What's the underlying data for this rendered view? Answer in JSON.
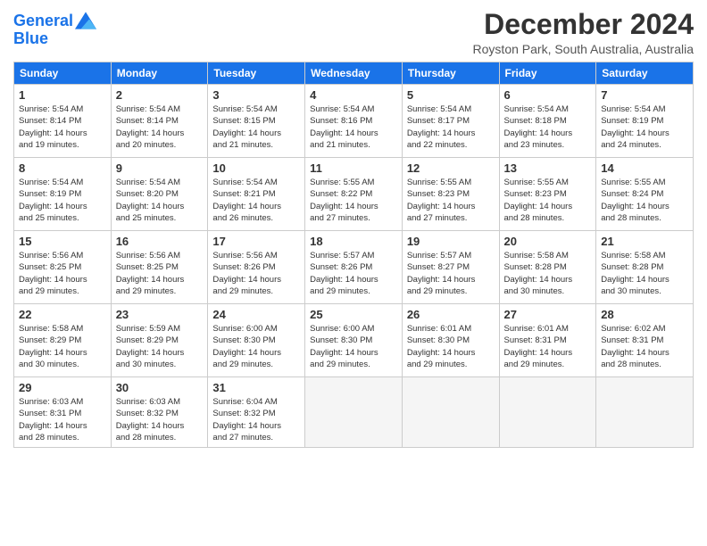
{
  "logo": {
    "line1": "General",
    "line2": "Blue"
  },
  "title": "December 2024",
  "subtitle": "Royston Park, South Australia, Australia",
  "days_header": [
    "Sunday",
    "Monday",
    "Tuesday",
    "Wednesday",
    "Thursday",
    "Friday",
    "Saturday"
  ],
  "weeks": [
    [
      {
        "day": "1",
        "info": "Sunrise: 5:54 AM\nSunset: 8:14 PM\nDaylight: 14 hours\nand 19 minutes."
      },
      {
        "day": "2",
        "info": "Sunrise: 5:54 AM\nSunset: 8:14 PM\nDaylight: 14 hours\nand 20 minutes."
      },
      {
        "day": "3",
        "info": "Sunrise: 5:54 AM\nSunset: 8:15 PM\nDaylight: 14 hours\nand 21 minutes."
      },
      {
        "day": "4",
        "info": "Sunrise: 5:54 AM\nSunset: 8:16 PM\nDaylight: 14 hours\nand 21 minutes."
      },
      {
        "day": "5",
        "info": "Sunrise: 5:54 AM\nSunset: 8:17 PM\nDaylight: 14 hours\nand 22 minutes."
      },
      {
        "day": "6",
        "info": "Sunrise: 5:54 AM\nSunset: 8:18 PM\nDaylight: 14 hours\nand 23 minutes."
      },
      {
        "day": "7",
        "info": "Sunrise: 5:54 AM\nSunset: 8:19 PM\nDaylight: 14 hours\nand 24 minutes."
      }
    ],
    [
      {
        "day": "8",
        "info": "Sunrise: 5:54 AM\nSunset: 8:19 PM\nDaylight: 14 hours\nand 25 minutes."
      },
      {
        "day": "9",
        "info": "Sunrise: 5:54 AM\nSunset: 8:20 PM\nDaylight: 14 hours\nand 25 minutes."
      },
      {
        "day": "10",
        "info": "Sunrise: 5:54 AM\nSunset: 8:21 PM\nDaylight: 14 hours\nand 26 minutes."
      },
      {
        "day": "11",
        "info": "Sunrise: 5:55 AM\nSunset: 8:22 PM\nDaylight: 14 hours\nand 27 minutes."
      },
      {
        "day": "12",
        "info": "Sunrise: 5:55 AM\nSunset: 8:23 PM\nDaylight: 14 hours\nand 27 minutes."
      },
      {
        "day": "13",
        "info": "Sunrise: 5:55 AM\nSunset: 8:23 PM\nDaylight: 14 hours\nand 28 minutes."
      },
      {
        "day": "14",
        "info": "Sunrise: 5:55 AM\nSunset: 8:24 PM\nDaylight: 14 hours\nand 28 minutes."
      }
    ],
    [
      {
        "day": "15",
        "info": "Sunrise: 5:56 AM\nSunset: 8:25 PM\nDaylight: 14 hours\nand 29 minutes."
      },
      {
        "day": "16",
        "info": "Sunrise: 5:56 AM\nSunset: 8:25 PM\nDaylight: 14 hours\nand 29 minutes."
      },
      {
        "day": "17",
        "info": "Sunrise: 5:56 AM\nSunset: 8:26 PM\nDaylight: 14 hours\nand 29 minutes."
      },
      {
        "day": "18",
        "info": "Sunrise: 5:57 AM\nSunset: 8:26 PM\nDaylight: 14 hours\nand 29 minutes."
      },
      {
        "day": "19",
        "info": "Sunrise: 5:57 AM\nSunset: 8:27 PM\nDaylight: 14 hours\nand 29 minutes."
      },
      {
        "day": "20",
        "info": "Sunrise: 5:58 AM\nSunset: 8:28 PM\nDaylight: 14 hours\nand 30 minutes."
      },
      {
        "day": "21",
        "info": "Sunrise: 5:58 AM\nSunset: 8:28 PM\nDaylight: 14 hours\nand 30 minutes."
      }
    ],
    [
      {
        "day": "22",
        "info": "Sunrise: 5:58 AM\nSunset: 8:29 PM\nDaylight: 14 hours\nand 30 minutes."
      },
      {
        "day": "23",
        "info": "Sunrise: 5:59 AM\nSunset: 8:29 PM\nDaylight: 14 hours\nand 30 minutes."
      },
      {
        "day": "24",
        "info": "Sunrise: 6:00 AM\nSunset: 8:30 PM\nDaylight: 14 hours\nand 29 minutes."
      },
      {
        "day": "25",
        "info": "Sunrise: 6:00 AM\nSunset: 8:30 PM\nDaylight: 14 hours\nand 29 minutes."
      },
      {
        "day": "26",
        "info": "Sunrise: 6:01 AM\nSunset: 8:30 PM\nDaylight: 14 hours\nand 29 minutes."
      },
      {
        "day": "27",
        "info": "Sunrise: 6:01 AM\nSunset: 8:31 PM\nDaylight: 14 hours\nand 29 minutes."
      },
      {
        "day": "28",
        "info": "Sunrise: 6:02 AM\nSunset: 8:31 PM\nDaylight: 14 hours\nand 28 minutes."
      }
    ],
    [
      {
        "day": "29",
        "info": "Sunrise: 6:03 AM\nSunset: 8:31 PM\nDaylight: 14 hours\nand 28 minutes."
      },
      {
        "day": "30",
        "info": "Sunrise: 6:03 AM\nSunset: 8:32 PM\nDaylight: 14 hours\nand 28 minutes."
      },
      {
        "day": "31",
        "info": "Sunrise: 6:04 AM\nSunset: 8:32 PM\nDaylight: 14 hours\nand 27 minutes."
      },
      {
        "day": "",
        "info": ""
      },
      {
        "day": "",
        "info": ""
      },
      {
        "day": "",
        "info": ""
      },
      {
        "day": "",
        "info": ""
      }
    ]
  ]
}
